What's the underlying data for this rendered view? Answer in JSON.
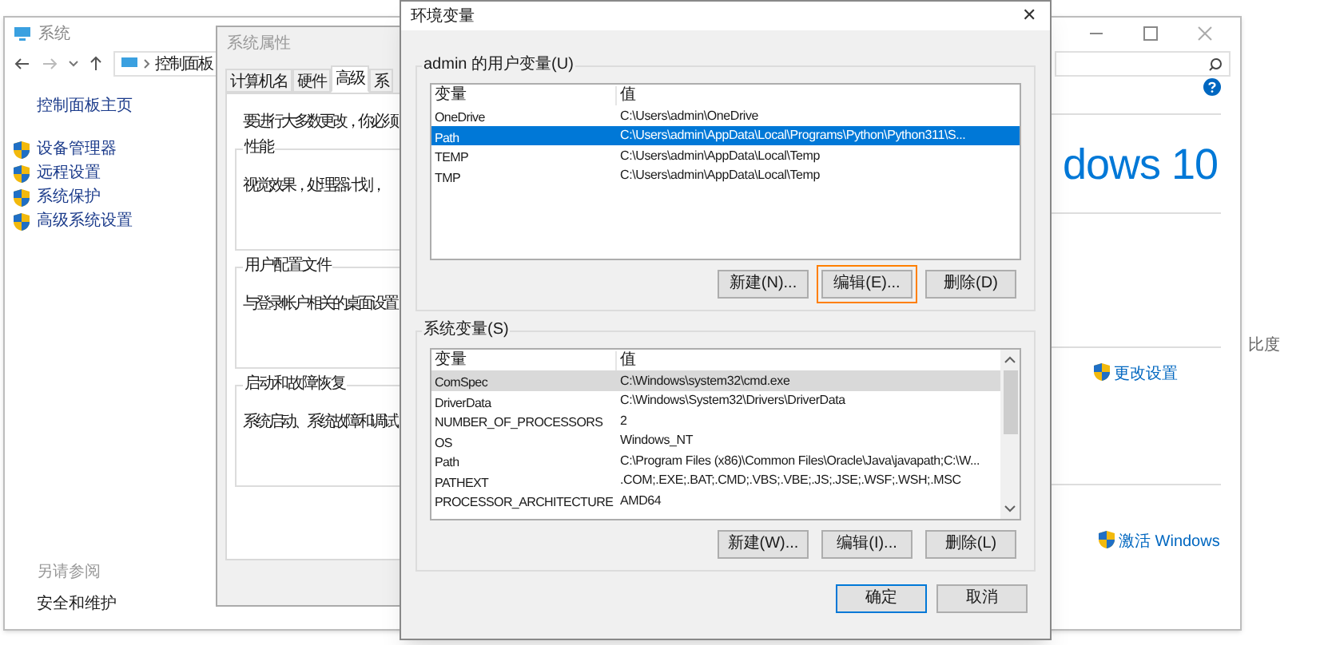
{
  "system_window": {
    "title": "系统",
    "breadcrumb": "控制面板",
    "sidebar_home": "控制面板主页",
    "sidebar_items": [
      {
        "label": "设备管理器"
      },
      {
        "label": "远程设置"
      },
      {
        "label": "系统保护"
      },
      {
        "label": "高级系统设置"
      }
    ],
    "see_also": "另请参阅",
    "see_also_link": "安全和维护",
    "brand_text": "dows 10",
    "change_settings": "更改设置",
    "activate": "激活 Windows",
    "fragment": "比度"
  },
  "system_properties": {
    "title": "系统属性",
    "tabs": [
      {
        "label": "计算机名",
        "selected": false
      },
      {
        "label": "硬件",
        "selected": false
      },
      {
        "label": "高级",
        "selected": true
      },
      {
        "label": "系",
        "selected": false
      }
    ],
    "intro": "要进行大多数更改，你必须",
    "groups": [
      {
        "title": "性能",
        "text": "视觉效果，处理器计划，"
      },
      {
        "title": "用户配置文件",
        "text": "与登录帐户相关的桌面设置"
      },
      {
        "title": "启动和故障恢复",
        "text": "系统启动、系统故障和调试"
      }
    ]
  },
  "env_dialog": {
    "title": "环境变量",
    "close": "✕",
    "user_vars": {
      "title": "admin 的用户变量(U)",
      "columns": [
        "变量",
        "值"
      ],
      "rows": [
        {
          "name": "OneDrive",
          "value": "C:\\Users\\admin\\OneDrive",
          "selected": false
        },
        {
          "name": "Path",
          "value": "C:\\Users\\admin\\AppData\\Local\\Programs\\Python\\Python311\\S...",
          "selected": true
        },
        {
          "name": "TEMP",
          "value": "C:\\Users\\admin\\AppData\\Local\\Temp",
          "selected": false
        },
        {
          "name": "TMP",
          "value": "C:\\Users\\admin\\AppData\\Local\\Temp",
          "selected": false
        }
      ],
      "buttons": [
        {
          "label": "新建(N)...",
          "focused": false
        },
        {
          "label": "编辑(E)...",
          "focused": true
        },
        {
          "label": "删除(D)",
          "focused": false
        }
      ]
    },
    "system_vars": {
      "title": "系统变量(S)",
      "columns": [
        "变量",
        "值"
      ],
      "rows": [
        {
          "name": "ComSpec",
          "value": "C:\\Windows\\system32\\cmd.exe",
          "selected": true
        },
        {
          "name": "DriverData",
          "value": "C:\\Windows\\System32\\Drivers\\DriverData",
          "selected": false
        },
        {
          "name": "NUMBER_OF_PROCESSORS",
          "value": "2",
          "selected": false
        },
        {
          "name": "OS",
          "value": "Windows_NT",
          "selected": false
        },
        {
          "name": "Path",
          "value": "C:\\Program Files (x86)\\Common Files\\Oracle\\Java\\javapath;C:\\W...",
          "selected": false
        },
        {
          "name": "PATHEXT",
          "value": ".COM;.EXE;.BAT;.CMD;.VBS;.VBE;.JS;.JSE;.WSF;.WSH;.MSC",
          "selected": false
        },
        {
          "name": "PROCESSOR_ARCHITECTURE",
          "value": "AMD64",
          "selected": false
        }
      ],
      "buttons": [
        {
          "label": "新建(W)...",
          "focused": false
        },
        {
          "label": "编辑(I)...",
          "focused": false
        },
        {
          "label": "删除(L)",
          "focused": false
        }
      ]
    },
    "buttons": [
      {
        "label": "确定",
        "default": true
      },
      {
        "label": "取消",
        "default": false
      }
    ]
  }
}
